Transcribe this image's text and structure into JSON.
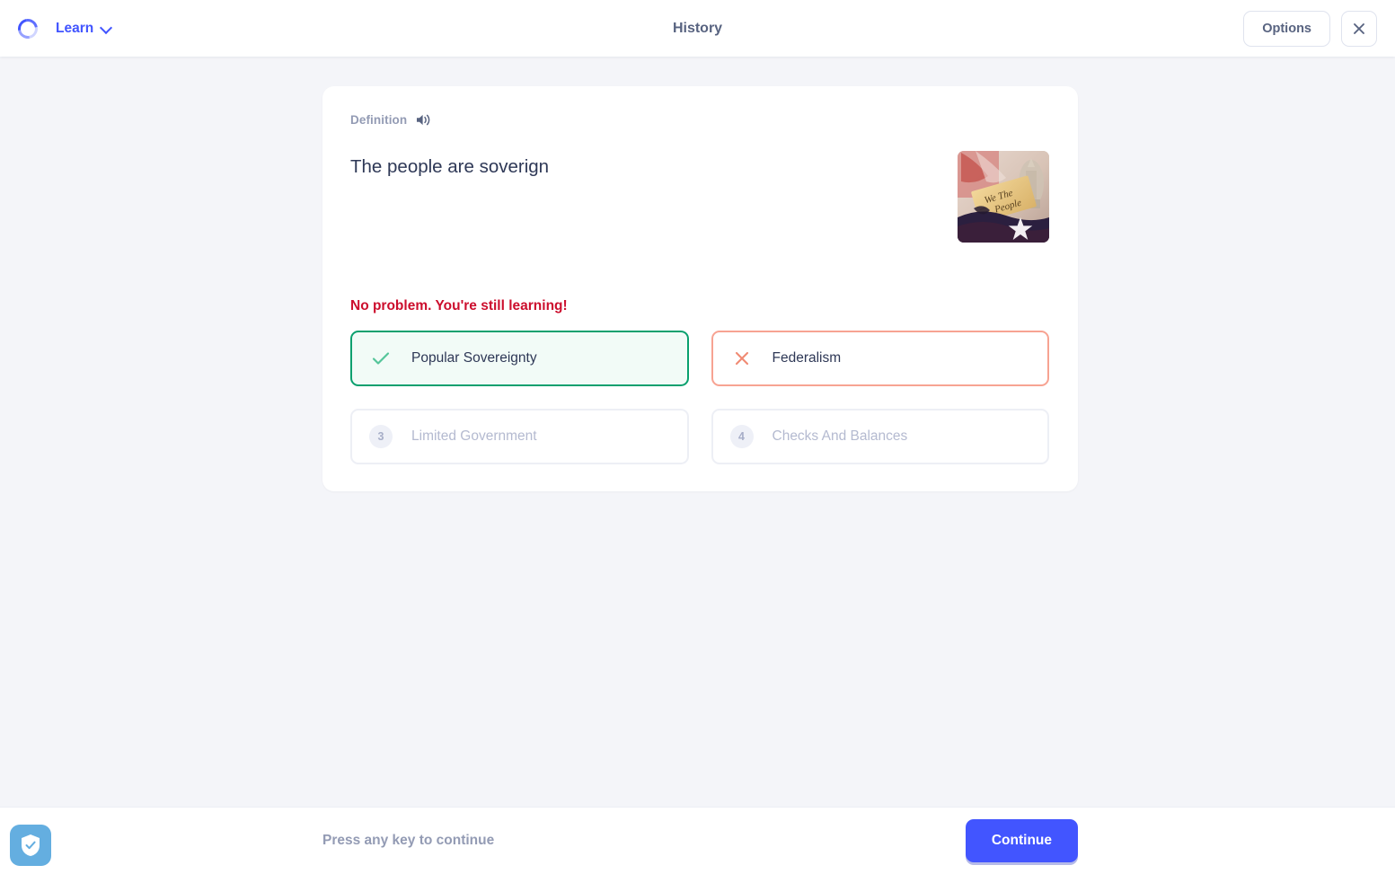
{
  "header": {
    "spinner_icon": "loading-spinner-icon",
    "learn_label": "Learn",
    "chevron_icon": "chevron-down-icon",
    "title": "History",
    "options_label": "Options",
    "close_icon": "close-icon"
  },
  "card": {
    "section_label": "Definition",
    "audio_icon": "speaker-icon",
    "prompt": "The people are soverign",
    "thumbnail_alt": "constitution-we-the-people-image",
    "feedback": "No problem. You're still learning!",
    "choices": [
      {
        "label": "Popular Sovereignty",
        "state": "correct",
        "marker": "check-icon"
      },
      {
        "label": "Federalism",
        "state": "incorrect",
        "marker": "x-icon"
      },
      {
        "label": "Limited Government",
        "state": "disabled",
        "marker": "3"
      },
      {
        "label": "Checks And Balances",
        "state": "disabled",
        "marker": "4"
      }
    ]
  },
  "footer": {
    "hint": "Press any key to continue",
    "continue_label": "Continue",
    "shield_icon": "shield-check-icon"
  },
  "colors": {
    "accent": "#4255ff",
    "correct": "#0aa06e",
    "incorrect": "#f7a392",
    "error_text": "#cc0e2d",
    "muted_text": "#939bb4",
    "page_bg": "#f4f5f9"
  }
}
